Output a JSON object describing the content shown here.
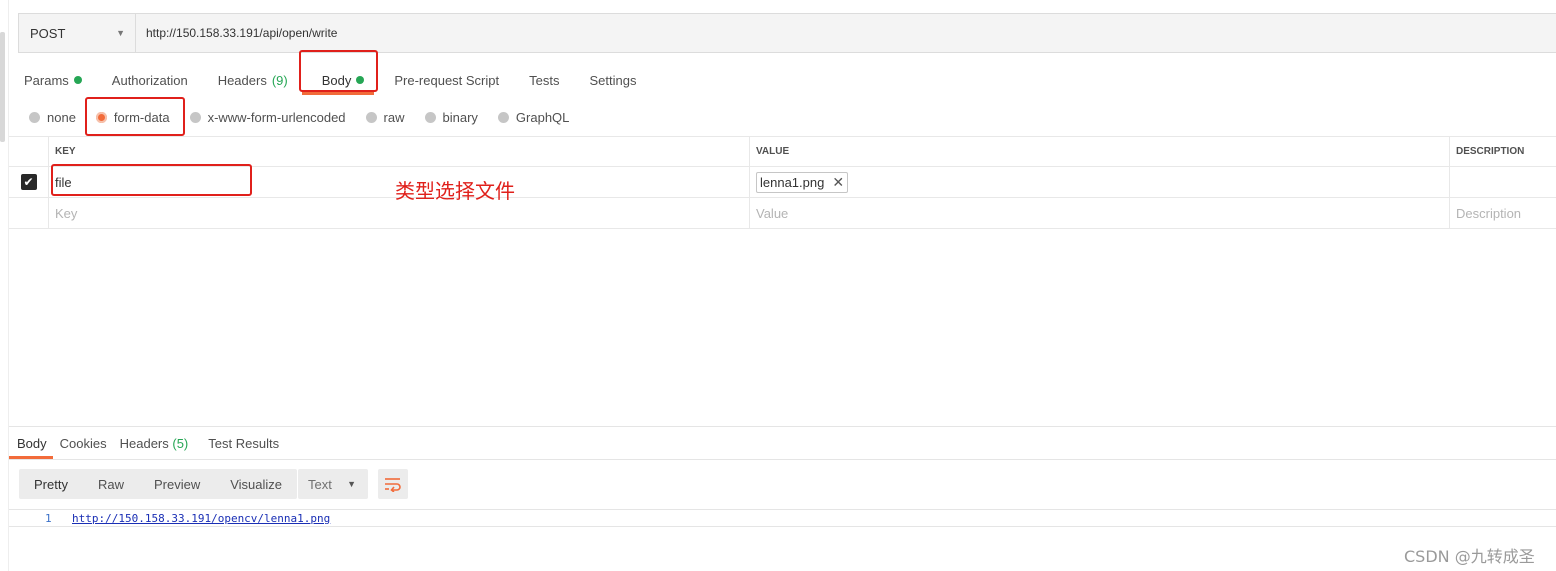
{
  "request": {
    "method": "POST",
    "url": "http://150.158.33.191/api/open/write"
  },
  "request_tabs": [
    {
      "label": "Params",
      "dot": true
    },
    {
      "label": "Authorization"
    },
    {
      "label": "Headers",
      "count": "(9)"
    },
    {
      "label": "Body",
      "dot": true,
      "active": true
    },
    {
      "label": "Pre-request Script"
    },
    {
      "label": "Tests"
    },
    {
      "label": "Settings"
    }
  ],
  "body_types": [
    {
      "label": "none"
    },
    {
      "label": "form-data",
      "selected": true
    },
    {
      "label": "x-www-form-urlencoded"
    },
    {
      "label": "raw"
    },
    {
      "label": "binary"
    },
    {
      "label": "GraphQL"
    }
  ],
  "form_table": {
    "headers": {
      "key": "KEY",
      "value": "VALUE",
      "description": "DESCRIPTION"
    },
    "rows": [
      {
        "checked": true,
        "key": "file",
        "value_file": "lenna1.png",
        "description": ""
      }
    ],
    "placeholders": {
      "key": "Key",
      "value": "Value",
      "description": "Description"
    }
  },
  "annotation": "类型选择文件",
  "response_tabs": [
    {
      "label": "Body",
      "active": true
    },
    {
      "label": "Cookies"
    },
    {
      "label": "Headers",
      "count": "(5)"
    },
    {
      "label": "Test Results"
    }
  ],
  "response_view": {
    "modes": [
      "Pretty",
      "Raw",
      "Preview",
      "Visualize"
    ],
    "format": "Text",
    "lines": [
      {
        "num": "1",
        "text": "http://150.158.33.191/opencv/lenna1.png"
      }
    ]
  },
  "watermark": "CSDN @九转成圣",
  "colors": {
    "accent": "#f26b3a",
    "success": "#26a655",
    "annotation": "#e0201b"
  }
}
